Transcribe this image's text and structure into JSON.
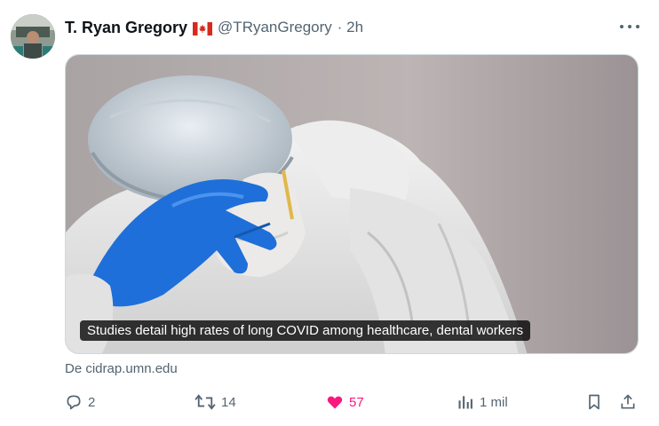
{
  "author": {
    "name": "T. Ryan Gregory",
    "flag": "canada-flag",
    "handle": "@TRyanGregory",
    "time": "· 2h"
  },
  "media": {
    "caption": "Studies detail high rates of long COVID among healthcare, dental workers"
  },
  "source": "De cidrap.umn.edu",
  "actions": {
    "replies": "2",
    "retweets": "14",
    "likes": "57",
    "views": "1 mil"
  },
  "icons": [
    "more-icon",
    "reply-icon",
    "retweet-icon",
    "heart-icon",
    "views-icon",
    "bookmark-icon",
    "share-icon"
  ],
  "colors": {
    "like": "#f91880",
    "muted": "#536471",
    "text": "#0f1419",
    "glove": "#1e6fd9"
  }
}
